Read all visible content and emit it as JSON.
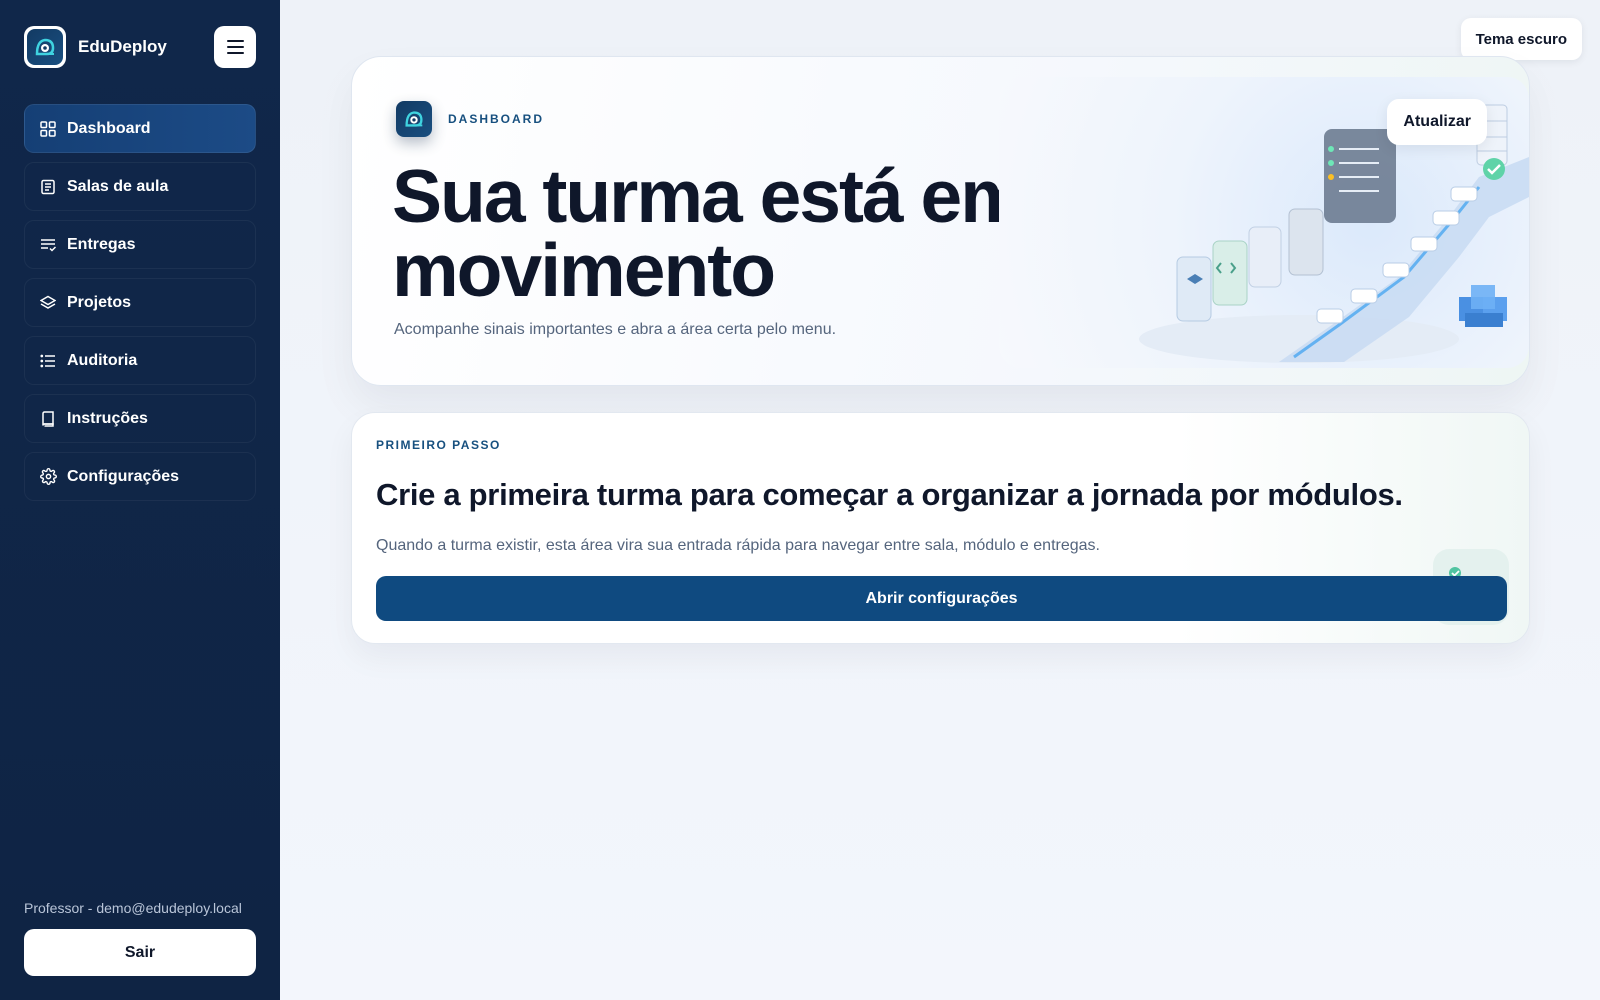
{
  "sidebar": {
    "brand_name": "EduDeploy",
    "menu_icon": "hamburger-icon",
    "items": [
      {
        "label": "Dashboard",
        "icon": "grid-icon",
        "active": true
      },
      {
        "label": "Salas de aula",
        "icon": "document-icon",
        "active": false
      },
      {
        "label": "Entregas",
        "icon": "list-check-icon",
        "active": false
      },
      {
        "label": "Projetos",
        "icon": "layers-icon",
        "active": false
      },
      {
        "label": "Auditoria",
        "icon": "list-icon",
        "active": false
      },
      {
        "label": "Instruções",
        "icon": "book-icon",
        "active": false
      },
      {
        "label": "Configurações",
        "icon": "gear-icon",
        "active": false
      }
    ],
    "user_label": "Professor - demo@edudeploy.local",
    "logout_label": "Sair"
  },
  "header": {
    "theme_button_label": "Tema escuro"
  },
  "hero": {
    "eyebrow": "DASHBOARD",
    "title": "Sua turma está em movimento",
    "subtitle": "Acompanhe sinais importantes e abra a área certa pelo menu.",
    "refresh_label": "Atualizar"
  },
  "step": {
    "eyebrow": "PRIMEIRO PASSO",
    "title": "Crie a primeira turma para começar a organizar a jornada por módulos.",
    "description": "Quando a turma existir, esta área vira sua entrada rápida para navegar entre sala, módulo e entregas.",
    "button_label": "Abrir configurações"
  },
  "colors": {
    "sidebar_bg": "#10274a",
    "active_nav": "#1c4b86",
    "primary_button": "#0f4a80",
    "eyebrow_text": "#17507f"
  }
}
